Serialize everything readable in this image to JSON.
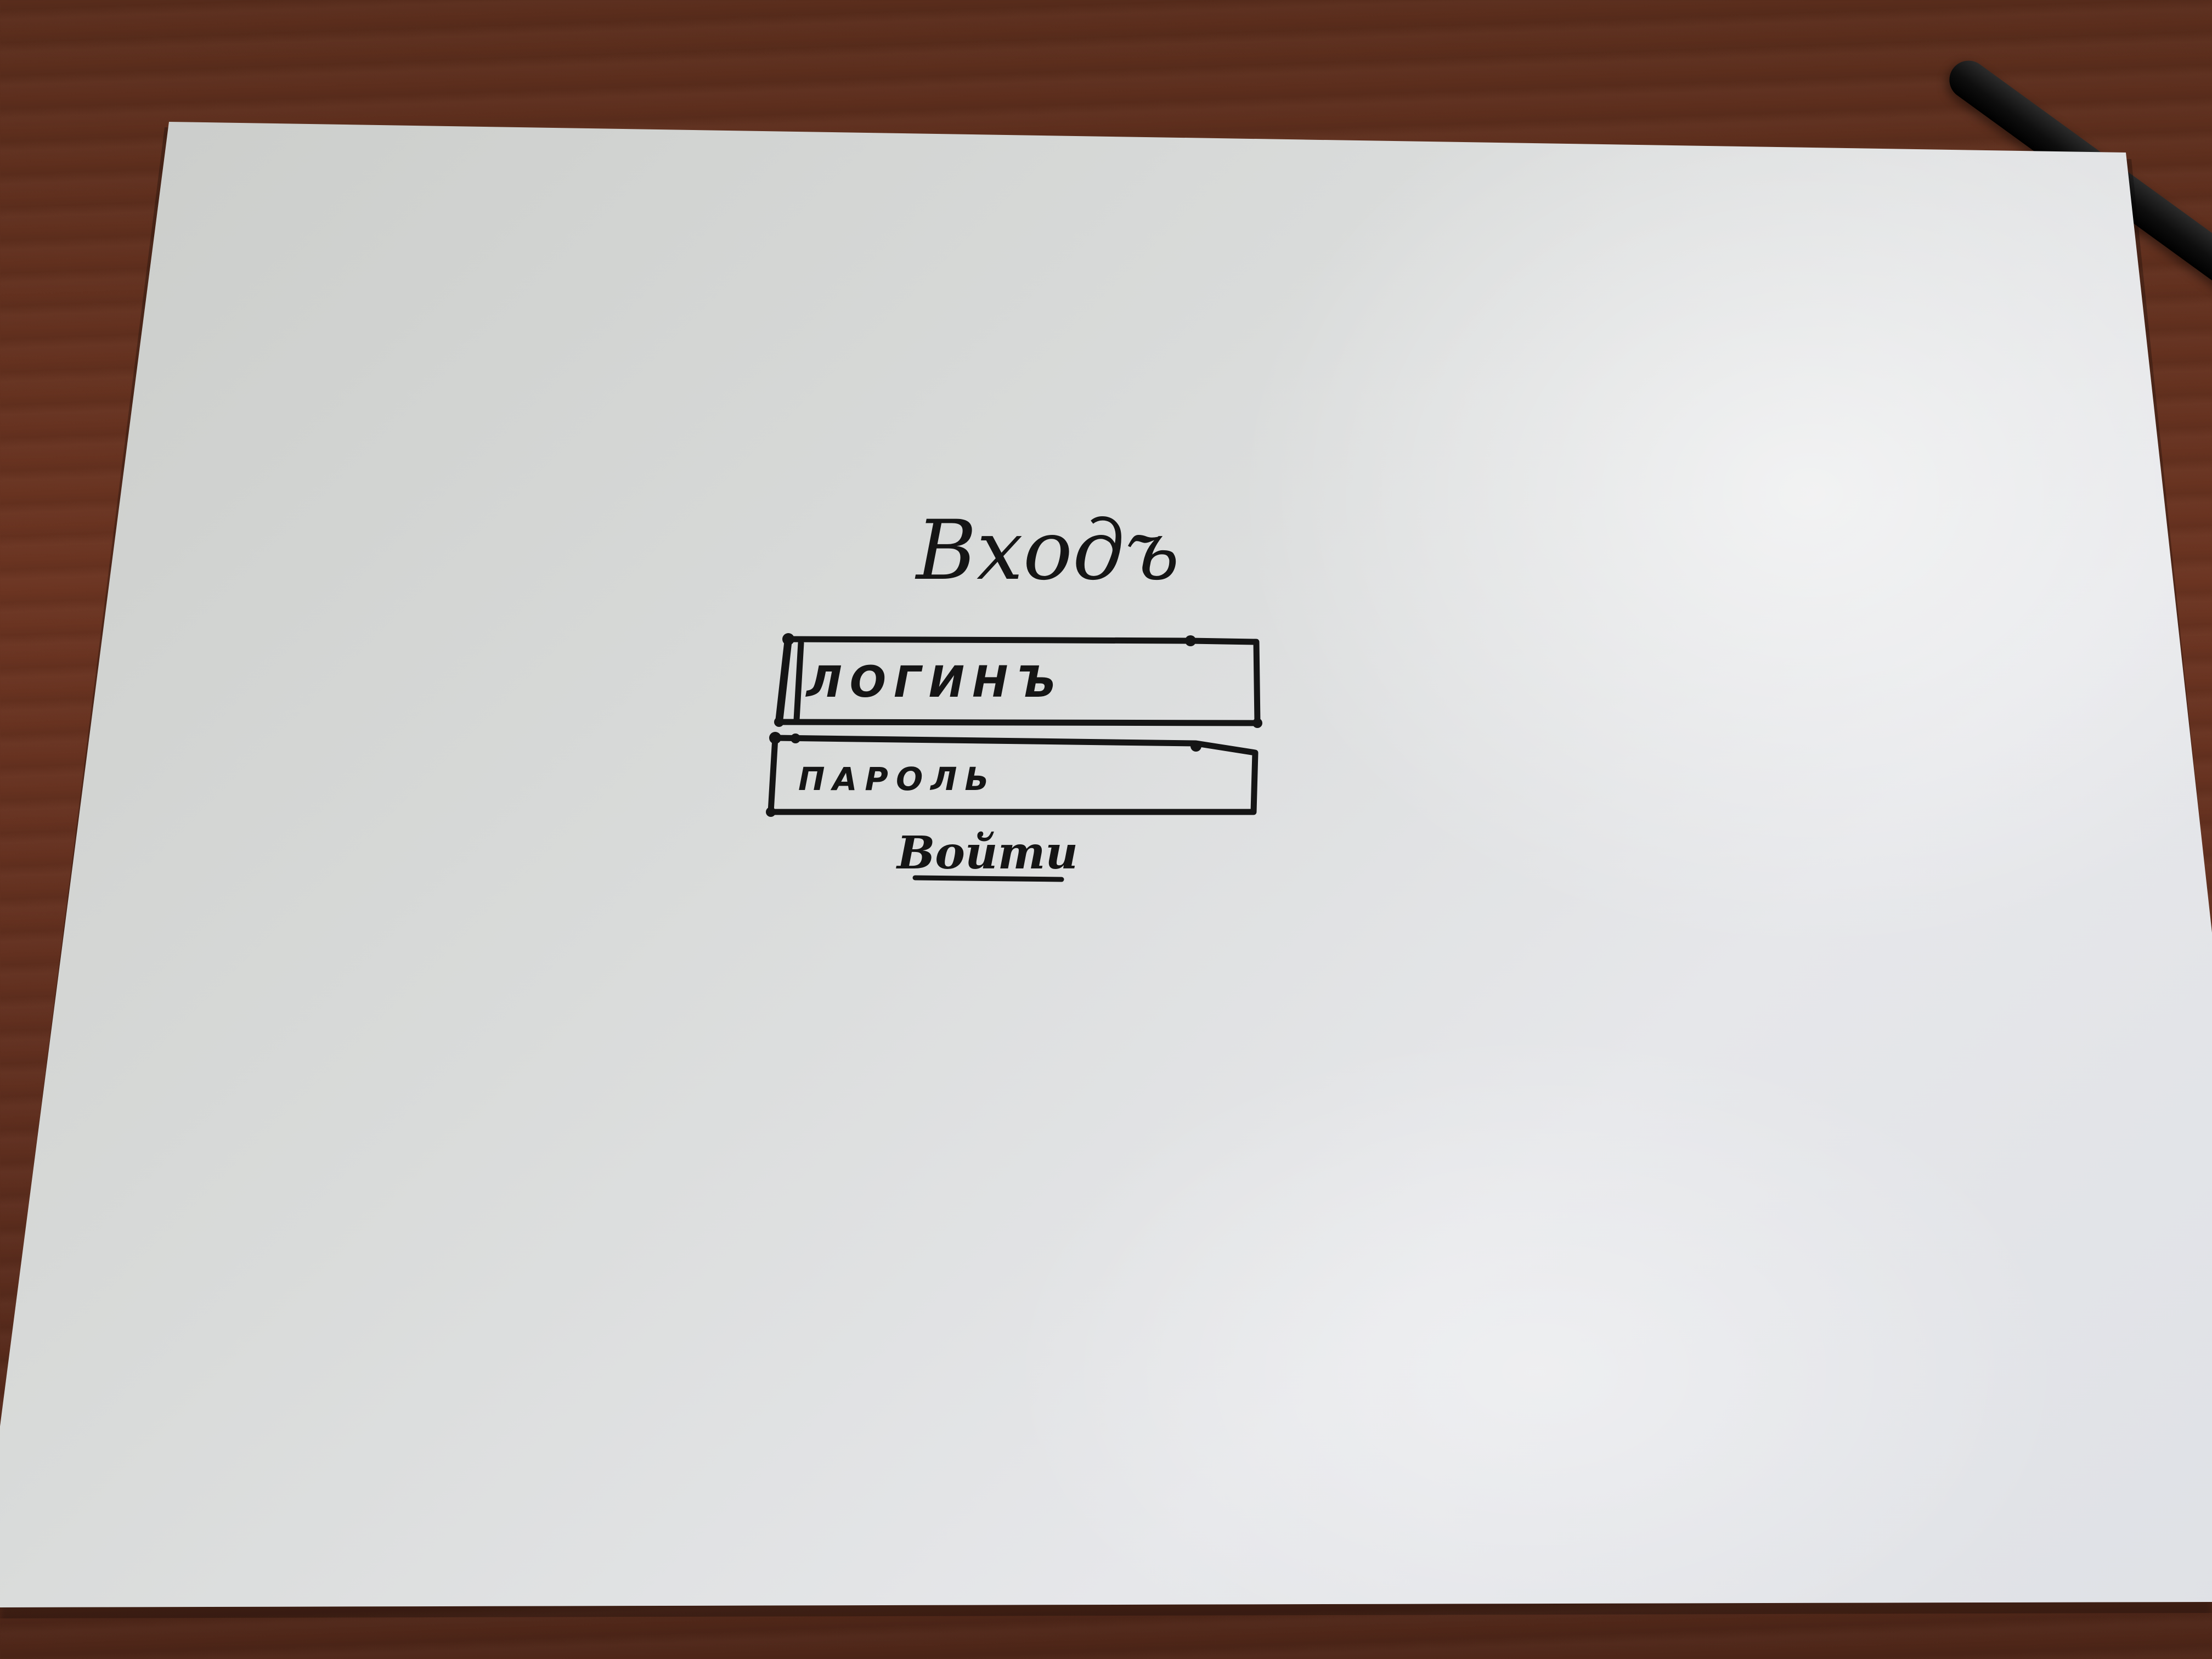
{
  "login_sketch": {
    "title": "Входъ",
    "login_field_text": "ЛОГИНЪ",
    "password_field_text": "ПАРОЛЬ",
    "submit_label": "Войти"
  },
  "colors": {
    "ink": "#151515",
    "paper": "#dcdedf",
    "desk": "#5e2e1e",
    "pen": "#0e0e0e"
  }
}
